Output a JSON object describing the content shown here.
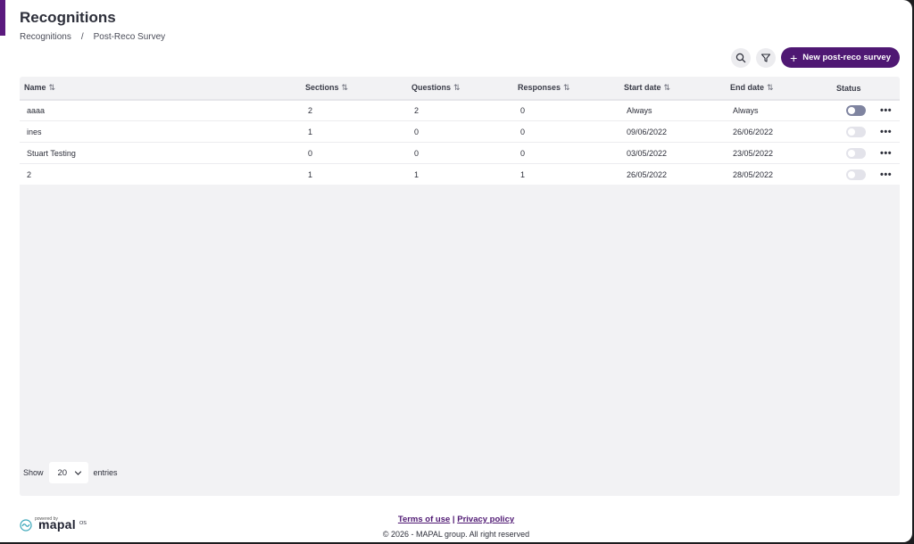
{
  "header": {
    "title": "Recognitions",
    "breadcrumb": {
      "parent": "Recognitions",
      "separator": "/",
      "current": "Post-Reco Survey"
    }
  },
  "toolbar": {
    "search_icon": "search-icon",
    "filter_icon": "filter-icon",
    "new_button_label": "New post-reco survey"
  },
  "table": {
    "columns": [
      "Name",
      "Sections",
      "Questions",
      "Responses",
      "Start date",
      "End date",
      "Status"
    ],
    "rows": [
      {
        "name": "aaaa",
        "sections": "2",
        "questions": "2",
        "responses": "0",
        "start": "Always",
        "end": "Always",
        "status": true
      },
      {
        "name": "ines",
        "sections": "1",
        "questions": "0",
        "responses": "0",
        "start": "09/06/2022",
        "end": "26/06/2022",
        "status": false
      },
      {
        "name": "Stuart Testing",
        "sections": "0",
        "questions": "0",
        "responses": "0",
        "start": "03/05/2022",
        "end": "23/05/2022",
        "status": false
      },
      {
        "name": "2",
        "sections": "1",
        "questions": "1",
        "responses": "1",
        "start": "26/05/2022",
        "end": "28/05/2022",
        "status": false
      }
    ],
    "more_label": "•••"
  },
  "pagination": {
    "show_label": "Show",
    "page_size": "20",
    "entries_label": "entries"
  },
  "footer": {
    "terms": "Terms of use",
    "divider": "|",
    "privacy": "Privacy policy",
    "copyright": "© 2026 - MAPAL group. All right reserved",
    "brand_powered": "powered by",
    "brand_name": "mapal",
    "brand_suffix": "OS"
  },
  "colors": {
    "accent": "#4f1873",
    "panel": "#f2f2f4",
    "toggle_on": "#7f84a0",
    "toggle_off": "#e3e3ea"
  }
}
